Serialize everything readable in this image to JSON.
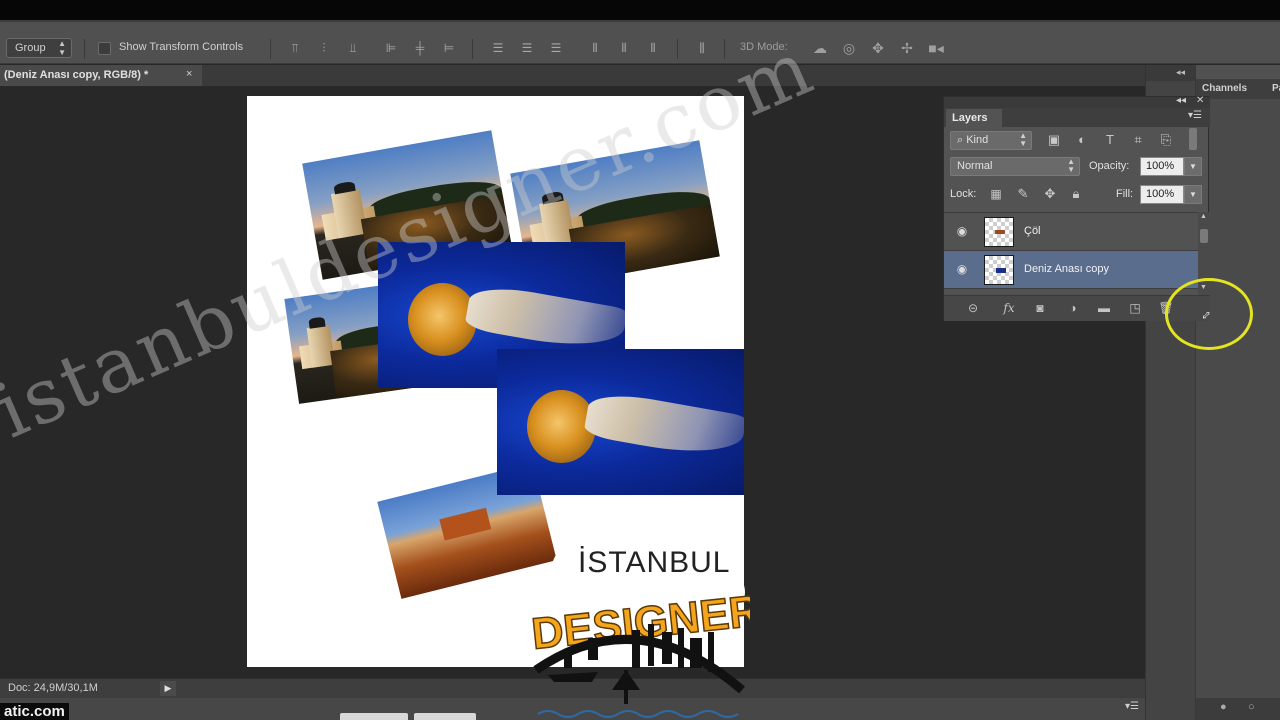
{
  "options_bar": {
    "auto_select_value": "Group",
    "show_transform_controls_label": "Show Transform Controls",
    "mode_label": "3D Mode:"
  },
  "document": {
    "tab_title": "(Deniz Anası copy, RGB/8) *",
    "close_glyph": "×"
  },
  "watermark": {
    "text": "istanbuldesigner.com"
  },
  "right_dock": {
    "tabs": [
      "Channels",
      "Pa"
    ],
    "top_controls": "◂◂"
  },
  "layers_panel": {
    "tab_label": "Layers",
    "kind_label": "Kind",
    "blend_mode": "Normal",
    "opacity_label": "Opacity:",
    "opacity_value": "100%",
    "lock_label": "Lock:",
    "fill_label": "Fill:",
    "fill_value": "100%",
    "layers": [
      {
        "name": "Çöl",
        "selected": false,
        "visible": true
      },
      {
        "name": "Deniz Anası copy",
        "selected": true,
        "visible": true
      }
    ]
  },
  "status_bar": {
    "doc_info": "Doc: 24,9M/30,1M"
  },
  "site_label": "atic.com",
  "logo": {
    "line1": "İSTANBUL",
    "line2": "DESIGNER"
  },
  "colors": {
    "app_background": "#282828",
    "panel": "#535353",
    "selected_layer": "#5b6d8c",
    "highlight_circle": "#e4e420",
    "logo_orange": "#f5a51c"
  }
}
